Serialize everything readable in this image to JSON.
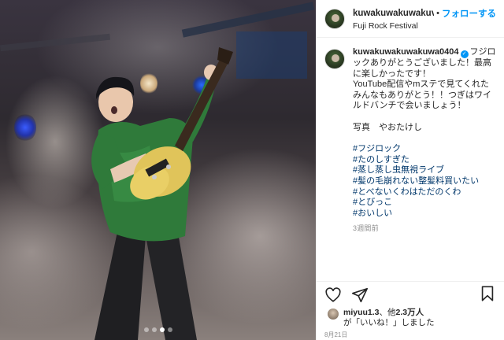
{
  "post": {
    "username": "kuwakuwakuwakuv",
    "separator": "•",
    "follow_label": "フォローする",
    "location": "Fuji Rock Festival"
  },
  "caption": {
    "username": "kuwakuwakuwakuwa0404",
    "verified_icon": "✓",
    "text": "フジロックありがとうございました！最高に楽しかったです！\nYouTube配信やmステで見てくれたみんなもありがとう！！つぎはワイルドバンチで会いましょう！\n\n写真　やおたけし",
    "hashtags": [
      "#フジロック",
      "#たのしすぎた",
      "#蒸し蒸し虫無視ライブ",
      "#髪の毛崩れない整髪料買いたい",
      "#とべないくわはただのくわ",
      "#とびっこ",
      "#おいしい"
    ],
    "time_ago": "3週間前"
  },
  "actions": {
    "like_icon": "heart-icon",
    "share_icon": "send-icon",
    "save_icon": "bookmark-icon"
  },
  "likes": {
    "user": "miyuu1.3",
    "middle": "、他",
    "count": "2.3万人",
    "suffix": "が「いいね！」しました"
  },
  "date": "8月21日",
  "carousel": {
    "total": 4,
    "active": 3
  }
}
